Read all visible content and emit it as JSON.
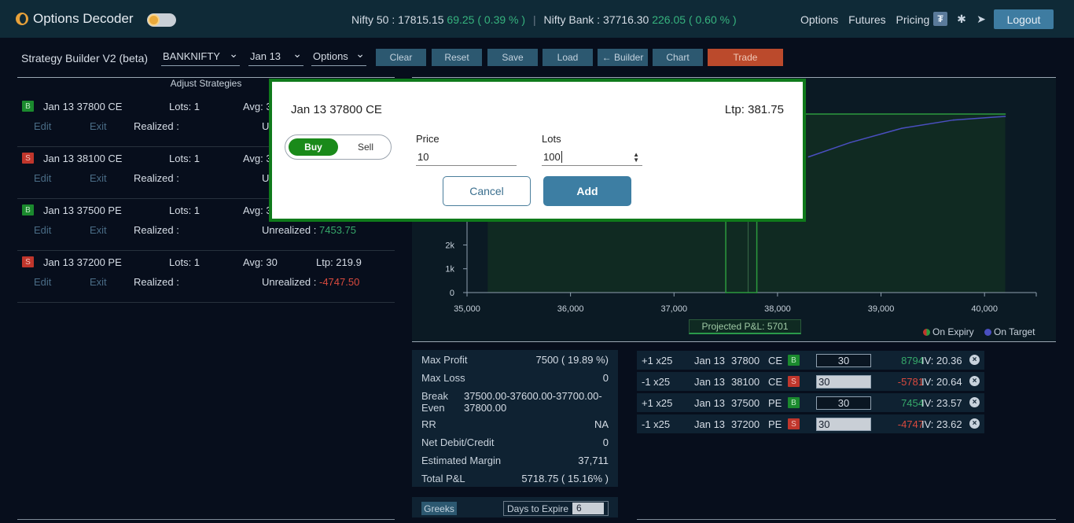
{
  "app": {
    "name": "Options Decoder",
    "ticker": {
      "nifty_label": "Nifty 50 : 17815.15",
      "nifty_change": "69.25 ( 0.39 % )",
      "bank_label": "Nifty Bank : 37716.30",
      "bank_change": "226.05 ( 0.60 % )"
    },
    "nav": [
      "Options",
      "Futures",
      "Pricing"
    ],
    "nav_icons": [
      "trading-platform-icon",
      "bug-icon",
      "telegram-icon"
    ],
    "logout": "Logout"
  },
  "toolbar": {
    "title": "Strategy Builder V2 (beta)",
    "symbol": "BANKNIFTY",
    "expiry": "Jan 13",
    "instrument": "Options",
    "buttons": [
      "Clear",
      "Reset",
      "Save",
      "Load",
      "← Builder",
      "Chart",
      "Trade"
    ]
  },
  "adjust": {
    "header": "Adjust Strategies",
    "legs": [
      {
        "side": "B",
        "name": "Jan 13 37800 CE",
        "lots": "Lots: 1",
        "avg": "Avg: 3",
        "ltp": "",
        "edit": "Edit",
        "exit": "Exit",
        "realized": "Realized :",
        "unrealized_label": "U",
        "unrealized_value": "",
        "pnl_color": "g"
      },
      {
        "side": "S",
        "name": "Jan 13 38100 CE",
        "lots": "Lots: 1",
        "avg": "Avg: 3",
        "ltp": "",
        "edit": "Edit",
        "exit": "Exit",
        "realized": "Realized :",
        "unrealized_label": "U",
        "unrealized_value": "",
        "pnl_color": "g"
      },
      {
        "side": "B",
        "name": "Jan 13 37500 PE",
        "lots": "Lots: 1",
        "avg": "Avg: 3",
        "ltp": "",
        "edit": "Edit",
        "exit": "Exit",
        "realized": "Realized :",
        "unrealized_label": "Unrealized :",
        "unrealized_value": "7453.75",
        "pnl_color": "g"
      },
      {
        "side": "S",
        "name": "Jan 13 37200 PE",
        "lots": "Lots: 1",
        "avg": "Avg: 30",
        "ltp": "Ltp: 219.9",
        "edit": "Edit",
        "exit": "Exit",
        "realized": "Realized :",
        "unrealized_label": "Unrealized :",
        "unrealized_value": "-4747.50",
        "pnl_color": "r"
      }
    ]
  },
  "chart_data": {
    "type": "line",
    "x_ticks": [
      "35,000",
      "36,000",
      "37,000",
      "38,000",
      "39,000",
      "40,000"
    ],
    "y_ticks": [
      "0",
      "1k",
      "2k"
    ],
    "xlim": [
      35000,
      40500
    ],
    "projected_pl": "Projected P&L: 5701",
    "legend": [
      {
        "name": "On Expiry",
        "color": "#2c9a3e",
        "color2": "#c0362c"
      },
      {
        "name": "On Target",
        "color": "#4a4fc0"
      }
    ],
    "series": [
      {
        "name": "On Expiry",
        "x": [
          35200,
          37500,
          37500,
          37800,
          37800,
          40200
        ],
        "y": [
          7500,
          7500,
          0,
          0,
          7500,
          7500
        ]
      },
      {
        "name": "On Target",
        "x": [
          38300,
          38700,
          39200,
          39700,
          40200
        ],
        "y": [
          5700,
          6300,
          6900,
          7250,
          7400
        ]
      }
    ],
    "spot": 37716.3
  },
  "stats": [
    {
      "k": "Max Profit",
      "v": "7500 ( 19.89 %)"
    },
    {
      "k": "Max Loss",
      "v": "0"
    },
    {
      "k": "Break",
      "k2": "Even",
      "v": "37500.00-37600.00-37700.00-",
      "v2": "37800.00"
    },
    {
      "k": "RR",
      "v": "NA"
    },
    {
      "k": "Net Debit/Credit",
      "v": "0"
    },
    {
      "k": "Estimated Margin",
      "v": "37,711"
    },
    {
      "k": "Total P&L",
      "v": "5718.75 ( 15.16% )"
    }
  ],
  "greeks": {
    "button": "Greeks",
    "dte_label": "Days to Expire",
    "dte_value": "6"
  },
  "positions": [
    {
      "qty": "+1 x25",
      "exp": "Jan 13",
      "strike": "37800",
      "type": "CE",
      "side": "B",
      "price": "30",
      "pnl": "8794",
      "pnl_color": "g",
      "iv": "IV: 20.36"
    },
    {
      "qty": "-1 x25",
      "exp": "Jan 13",
      "strike": "38100",
      "type": "CE",
      "side": "S",
      "price": "30",
      "pnl": "-5781",
      "pnl_color": "r",
      "iv": "IV: 20.64"
    },
    {
      "qty": "+1 x25",
      "exp": "Jan 13",
      "strike": "37500",
      "type": "PE",
      "side": "B",
      "price": "30",
      "pnl": "7454",
      "pnl_color": "g",
      "iv": "IV: 23.57"
    },
    {
      "qty": "-1 x25",
      "exp": "Jan 13",
      "strike": "37200",
      "type": "PE",
      "side": "S",
      "price": "30",
      "pnl": "-4747",
      "pnl_color": "r",
      "iv": "IV: 23.62"
    }
  ],
  "modal": {
    "title": "Jan 13 37800 CE",
    "ltp": "Ltp: 381.75",
    "buy": "Buy",
    "sell": "Sell",
    "price_label": "Price",
    "price_value": "10",
    "lots_label": "Lots",
    "lots_value": "100",
    "cancel": "Cancel",
    "add": "Add"
  }
}
